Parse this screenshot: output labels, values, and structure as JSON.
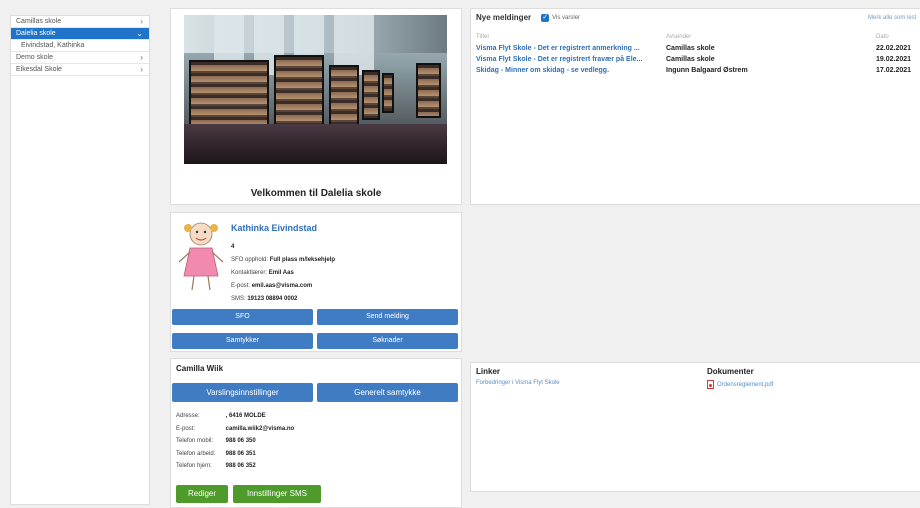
{
  "sidebar": {
    "items": [
      {
        "label": "Camillas skole"
      },
      {
        "label": "Dalelia skole"
      },
      {
        "label": "Eivindstad, Kathinka"
      },
      {
        "label": "Demo skole"
      },
      {
        "label": "Eikesdal Skole"
      }
    ]
  },
  "school": {
    "welcome": "Velkommen til Dalelia skole"
  },
  "messages": {
    "title": "Nye meldinger",
    "show_alerts": "Vis varsler",
    "mark_all": "Merk alle som lest",
    "col_title": "Tittel",
    "col_sender": "Avsender",
    "col_date": "Dato",
    "rows": [
      {
        "title": "Visma Flyt Skole - Det er registrert anmerkning ...",
        "sender": "Camillas skole",
        "date": "22.02.2021"
      },
      {
        "title": "Visma Flyt Skole - Det er registrert fravær på Ele...",
        "sender": "Camillas skole",
        "date": "19.02.2021"
      },
      {
        "title": "Skidag - Minner om skidag - se vedlegg.",
        "sender": "Ingunn Balgaard Østrem",
        "date": "17.02.2021"
      }
    ]
  },
  "student": {
    "name": "Kathinka Eivindstad",
    "grade": "4",
    "sfo_label": "SFO opphold:",
    "sfo_value": "Full plass m/leksehjelp",
    "contact_label": "Kontaktlærer:",
    "contact_value": "Emil Aas",
    "email_label": "E-post:",
    "email_value": "emil.aas@visma.com",
    "sms_label": "SMS:",
    "sms_value": "19123 08894 0002",
    "btn_sfo": "SFO",
    "btn_send": "Send melding",
    "btn_consent": "Samtykker",
    "btn_apply": "Søknader"
  },
  "parent": {
    "name": "Camilla Wiik",
    "btn_alerts": "Varslingsinnstillinger",
    "btn_consent": "Generelt samtykke",
    "address_label": "Adresse:",
    "address_value": ", 6416 MOLDE",
    "email_label": "E-post:",
    "email_value": "camilla.wiik2@visma.no",
    "mobile_label": "Telefon mobil:",
    "mobile_value": "988 06 350",
    "work_label": "Telefon arbeid:",
    "work_value": "988 06 351",
    "home_label": "Telefon hjem:",
    "home_value": "988 06 352",
    "btn_edit": "Rediger",
    "btn_sms": "Innstillinger SMS"
  },
  "links": {
    "title": "Linker",
    "item": "Forbedringer i Visma Flyt Skole",
    "docs_title": "Dokumenter",
    "doc_item": "Ordensreglement.pdf"
  }
}
